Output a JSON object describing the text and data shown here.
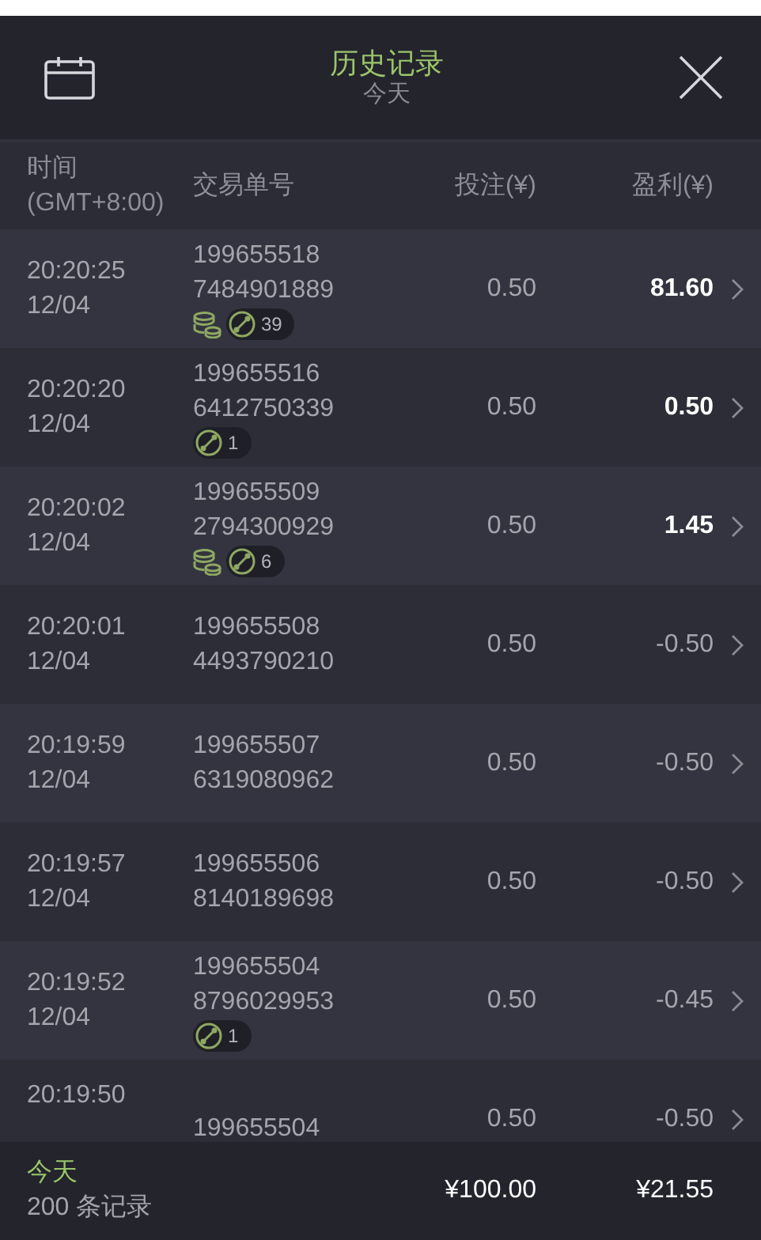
{
  "header": {
    "title": "历史记录",
    "subtitle": "今天"
  },
  "columns": {
    "time": "时间",
    "timezone": "(GMT+8:00)",
    "order": "交易单号",
    "stake": "投注(¥)",
    "profit": "盈利(¥)"
  },
  "rows": [
    {
      "time": "20:20:25",
      "date": "12/04",
      "order_a": "199655518",
      "order_b": "7484901889",
      "badge": {
        "coins": true,
        "count": "39"
      },
      "stake": "0.50",
      "profit": "81.60",
      "won": true
    },
    {
      "time": "20:20:20",
      "date": "12/04",
      "order_a": "199655516",
      "order_b": "6412750339",
      "badge": {
        "coins": false,
        "count": "1"
      },
      "stake": "0.50",
      "profit": "0.50",
      "won": true
    },
    {
      "time": "20:20:02",
      "date": "12/04",
      "order_a": "199655509",
      "order_b": "2794300929",
      "badge": {
        "coins": true,
        "count": "6"
      },
      "stake": "0.50",
      "profit": "1.45",
      "won": true
    },
    {
      "time": "20:20:01",
      "date": "12/04",
      "order_a": "199655508",
      "order_b": "4493790210",
      "stake": "0.50",
      "profit": "-0.50",
      "won": false
    },
    {
      "time": "20:19:59",
      "date": "12/04",
      "order_a": "199655507",
      "order_b": "6319080962",
      "stake": "0.50",
      "profit": "-0.50",
      "won": false
    },
    {
      "time": "20:19:57",
      "date": "12/04",
      "order_a": "199655506",
      "order_b": "8140189698",
      "stake": "0.50",
      "profit": "-0.50",
      "won": false
    },
    {
      "time": "20:19:52",
      "date": "12/04",
      "order_a": "199655504",
      "order_b": "8796029953",
      "badge": {
        "coins": false,
        "count": "1"
      },
      "stake": "0.50",
      "profit": "-0.45",
      "won": false
    },
    {
      "time": "20:19:50",
      "order_a": "199655504",
      "stake": "0.50",
      "profit": "-0.50",
      "won": false
    }
  ],
  "footer": {
    "period": "今天",
    "records": "200 条记录",
    "stake_total": "¥100.00",
    "profit_total": "¥21.55"
  }
}
